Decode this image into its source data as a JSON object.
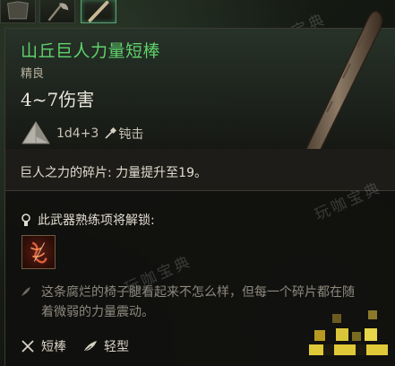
{
  "item": {
    "name": "山丘巨人力量短棒",
    "rarity": "精良",
    "damage": "4~7伤害",
    "dice": "1d4+3",
    "damage_type": "钝击",
    "rarity_color": "#5fd26b"
  },
  "passive": "巨人之力的碎片: 力量提升至19。",
  "proficiency": {
    "label": "此武器熟练项将解锁:",
    "action_icon": "flame-slash-icon"
  },
  "flavor": "这条腐烂的椅子腿看起来不怎么样，但每一个碎片都在随着微弱的力量震动。",
  "tags": [
    {
      "label": "短棒",
      "icon": "crossed-clubs-icon"
    },
    {
      "label": "轻型",
      "icon": "feather-icon"
    }
  ],
  "watermark": "玩咖宝典"
}
